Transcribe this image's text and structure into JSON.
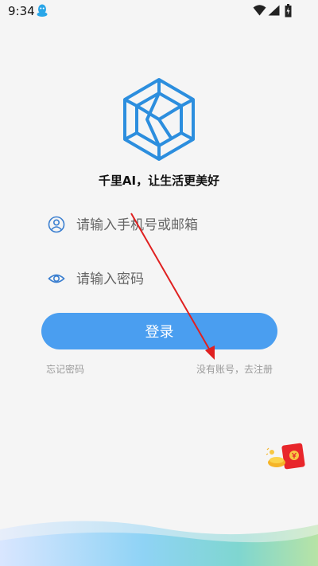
{
  "status_bar": {
    "time": "9:34"
  },
  "app": {
    "slogan": "千里AI，让生活更美好"
  },
  "login_form": {
    "phone_placeholder": "请输入手机号或邮箱",
    "password_placeholder": "请输入密码",
    "login_label": "登录",
    "forgot_password_label": "忘记密码",
    "register_label": "没有账号，去注册"
  },
  "colors": {
    "accent": "#4a9ef0",
    "logo_blue": "#2c8ede",
    "annotation_red": "#e02020",
    "link_gray": "#999999"
  },
  "icons": [
    "qq-icon",
    "wifi-icon",
    "signal-icon",
    "battery-icon",
    "app-logo-icon",
    "user-icon",
    "eye-icon",
    "red-packet-icon"
  ]
}
